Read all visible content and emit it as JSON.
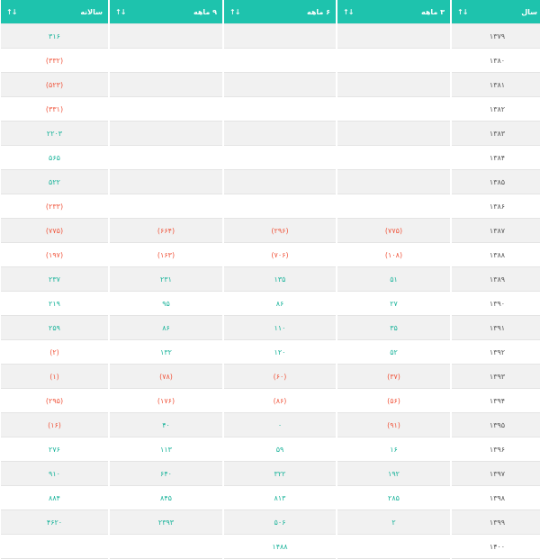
{
  "table": {
    "headers": [
      {
        "label": "سال",
        "sort_icon": "sort-icon"
      },
      {
        "label": "۳ ماهه",
        "sort_icon": "sort-icon"
      },
      {
        "label": "۶ ماهه",
        "sort_icon": "sort-icon"
      },
      {
        "label": "۹ ماهه",
        "sort_icon": "sort-icon"
      },
      {
        "label": "سالانه",
        "sort_icon": "sort-icon"
      }
    ],
    "sort_glyph": "↓↑",
    "colors": {
      "header_bg": "#1ec3ad",
      "positive": "#19b39a",
      "negative": "#f0573e"
    },
    "rows": [
      {
        "year": "۱۳۷۹",
        "m3": "",
        "m6": "",
        "m9": "",
        "annual": "۳۱۶"
      },
      {
        "year": "۱۳۸۰",
        "m3": "",
        "m6": "",
        "m9": "",
        "annual": "(۳۳۲)"
      },
      {
        "year": "۱۳۸۱",
        "m3": "",
        "m6": "",
        "m9": "",
        "annual": "(۵۲۳)"
      },
      {
        "year": "۱۳۸۲",
        "m3": "",
        "m6": "",
        "m9": "",
        "annual": "(۳۳۱)"
      },
      {
        "year": "۱۳۸۳",
        "m3": "",
        "m6": "",
        "m9": "",
        "annual": "۲۲۰۳"
      },
      {
        "year": "۱۳۸۴",
        "m3": "",
        "m6": "",
        "m9": "",
        "annual": "۵۶۵"
      },
      {
        "year": "۱۳۸۵",
        "m3": "",
        "m6": "",
        "m9": "",
        "annual": "۵۲۲"
      },
      {
        "year": "۱۳۸۶",
        "m3": "",
        "m6": "",
        "m9": "",
        "annual": "(۲۳۳)"
      },
      {
        "year": "۱۳۸۷",
        "m3": "(۷۷۵)",
        "m6": "(۲۹۶)",
        "m9": "(۶۶۴)",
        "annual": "(۷۷۵)"
      },
      {
        "year": "۱۳۸۸",
        "m3": "(۱۰۸)",
        "m6": "(۷۰۶)",
        "m9": "(۱۶۳)",
        "annual": "(۱۹۷)"
      },
      {
        "year": "۱۳۸۹",
        "m3": "۵۱",
        "m6": "۱۳۵",
        "m9": "۲۳۱",
        "annual": "۲۳۷"
      },
      {
        "year": "۱۳۹۰",
        "m3": "۲۷",
        "m6": "۸۶",
        "m9": "۹۵",
        "annual": "۲۱۹"
      },
      {
        "year": "۱۳۹۱",
        "m3": "۳۵",
        "m6": "۱۱۰",
        "m9": "۸۶",
        "annual": "۲۵۹"
      },
      {
        "year": "۱۳۹۲",
        "m3": "۵۲",
        "m6": "۱۲۰",
        "m9": "۱۳۲",
        "annual": "(۲)"
      },
      {
        "year": "۱۳۹۳",
        "m3": "(۳۷)",
        "m6": "(۶۰)",
        "m9": "(۷۸)",
        "annual": "(۱)"
      },
      {
        "year": "۱۳۹۴",
        "m3": "(۵۶)",
        "m6": "(۸۶)",
        "m9": "(۱۷۶)",
        "annual": "(۲۹۵)"
      },
      {
        "year": "۱۳۹۵",
        "m3": "(۹۱)",
        "m6": "۰",
        "m9": "۴۰",
        "annual": "(۱۶)"
      },
      {
        "year": "۱۳۹۶",
        "m3": "۱۶",
        "m6": "۵۹",
        "m9": "۱۱۳",
        "annual": "۲۷۶"
      },
      {
        "year": "۱۳۹۷",
        "m3": "۱۹۲",
        "m6": "۳۲۲",
        "m9": "۶۴۰",
        "annual": "۹۱۰"
      },
      {
        "year": "۱۳۹۸",
        "m3": "۲۸۵",
        "m6": "۸۱۳",
        "m9": "۸۴۵",
        "annual": "۸۸۴"
      },
      {
        "year": "۱۳۹۹",
        "m3": "۲",
        "m6": "۵۰۶",
        "m9": "۲۳۹۳",
        "annual": "۴۶۲۰"
      },
      {
        "year": "۱۴۰۰",
        "m3": "",
        "m6": "۱۴۸۸",
        "m9": "",
        "annual": ""
      }
    ]
  }
}
